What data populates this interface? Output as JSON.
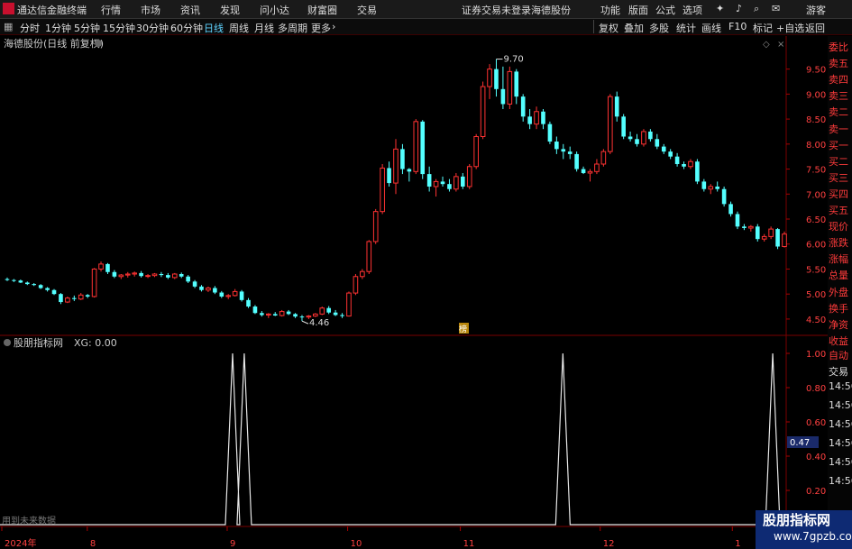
{
  "menubar": {
    "app_title": "通达信金融终端",
    "items": [
      "行情",
      "市场",
      "资讯",
      "发现",
      "问小达",
      "财富圈",
      "交易"
    ],
    "warning": "证券交易未登录",
    "stock_name": "海德股份",
    "right_items": [
      "功能",
      "版面",
      "公式",
      "选项"
    ],
    "user": "游客"
  },
  "toolbar": {
    "periods": [
      "分时",
      "1分钟",
      "5分钟",
      "15分钟",
      "30分钟",
      "60分钟",
      "日线",
      "周线",
      "月线",
      "多周期",
      "更多"
    ],
    "active_period": "日线",
    "right_items": [
      "复权",
      "叠加",
      "多股",
      "统计",
      "画线",
      "F10",
      "标记",
      "+自选",
      "返回"
    ]
  },
  "main_chart": {
    "title": "海德股份(日线 前复权)",
    "high_label": "9.70",
    "low_label": "4.46",
    "badge": "榜",
    "y_ticks": [
      "9.50",
      "9.00",
      "8.50",
      "8.00",
      "7.50",
      "7.00",
      "6.50",
      "6.00",
      "5.50",
      "5.00",
      "4.50"
    ]
  },
  "indicator": {
    "title": "股朋指标网",
    "value_label": "XG: 0.00",
    "y_ticks": [
      "1.00",
      "0.80",
      "0.60",
      "0.40",
      "0.20"
    ],
    "current_value": "0.47",
    "footnote": "用到未来数据"
  },
  "x_axis": {
    "labels": [
      "2024年",
      "8",
      "9",
      "10",
      "11",
      "12",
      "1"
    ]
  },
  "right_panel": {
    "side_labels": [
      "委比",
      "卖五",
      "卖四",
      "卖三",
      "卖二",
      "卖一",
      "买一",
      "买二",
      "买三",
      "买四",
      "买五",
      "现价",
      "涨跌",
      "涨幅",
      "总量",
      "外盘",
      "换手",
      "净资",
      "收益"
    ],
    "auto_label": "自动",
    "trade_label": "交易",
    "times": [
      "14:56",
      "14:56",
      "14:56",
      "14:56",
      "14:56",
      "14:56"
    ]
  },
  "watermark": {
    "line1": "股朋指标网",
    "line2": "www.7gpzb.com"
  },
  "chart_data": {
    "type": "candlestick",
    "title": "海德股份(日线 前复权)",
    "ylim": [
      4.3,
      9.8
    ],
    "x_labels": [
      "2024年",
      "8",
      "9",
      "10",
      "11",
      "12",
      "1"
    ],
    "candles": [
      [
        5.3,
        5.33,
        5.26,
        5.28
      ],
      [
        5.28,
        5.3,
        5.24,
        5.27
      ],
      [
        5.27,
        5.29,
        5.22,
        5.23
      ],
      [
        5.23,
        5.25,
        5.18,
        5.2
      ],
      [
        5.2,
        5.22,
        5.16,
        5.18
      ],
      [
        5.18,
        5.2,
        5.1,
        5.12
      ],
      [
        5.12,
        5.14,
        5.05,
        5.08
      ],
      [
        5.08,
        5.1,
        4.98,
        5.0
      ],
      [
        5.0,
        5.02,
        4.8,
        4.84
      ],
      [
        4.84,
        4.95,
        4.82,
        4.92
      ],
      [
        4.92,
        4.97,
        4.86,
        4.9
      ],
      [
        4.9,
        5.02,
        4.88,
        4.98
      ],
      [
        4.98,
        5.0,
        4.92,
        4.95
      ],
      [
        4.95,
        5.52,
        4.93,
        5.5
      ],
      [
        5.5,
        5.65,
        5.45,
        5.6
      ],
      [
        5.6,
        5.62,
        5.4,
        5.44
      ],
      [
        5.44,
        5.48,
        5.32,
        5.35
      ],
      [
        5.35,
        5.4,
        5.3,
        5.38
      ],
      [
        5.38,
        5.44,
        5.33,
        5.4
      ],
      [
        5.4,
        5.45,
        5.35,
        5.42
      ],
      [
        5.42,
        5.46,
        5.33,
        5.36
      ],
      [
        5.36,
        5.4,
        5.32,
        5.37
      ],
      [
        5.37,
        5.42,
        5.34,
        5.4
      ],
      [
        5.4,
        5.44,
        5.34,
        5.38
      ],
      [
        5.38,
        5.42,
        5.3,
        5.33
      ],
      [
        5.33,
        5.42,
        5.3,
        5.4
      ],
      [
        5.4,
        5.43,
        5.32,
        5.35
      ],
      [
        5.35,
        5.38,
        5.22,
        5.25
      ],
      [
        5.25,
        5.28,
        5.12,
        5.15
      ],
      [
        5.15,
        5.18,
        5.05,
        5.08
      ],
      [
        5.08,
        5.15,
        5.04,
        5.12
      ],
      [
        5.12,
        5.16,
        5.0,
        5.03
      ],
      [
        5.03,
        5.06,
        4.92,
        4.95
      ],
      [
        4.95,
        5.0,
        4.9,
        4.97
      ],
      [
        4.97,
        5.1,
        4.95,
        5.05
      ],
      [
        5.05,
        5.08,
        4.85,
        4.88
      ],
      [
        4.88,
        4.92,
        4.72,
        4.75
      ],
      [
        4.75,
        4.78,
        4.6,
        4.62
      ],
      [
        4.62,
        4.66,
        4.55,
        4.58
      ],
      [
        4.58,
        4.62,
        4.52,
        4.6
      ],
      [
        4.6,
        4.64,
        4.56,
        4.57
      ],
      [
        4.57,
        4.68,
        4.55,
        4.65
      ],
      [
        4.65,
        4.68,
        4.58,
        4.6
      ],
      [
        4.6,
        4.62,
        4.52,
        4.55
      ],
      [
        4.55,
        4.58,
        4.46,
        4.54
      ],
      [
        4.54,
        4.58,
        4.5,
        4.56
      ],
      [
        4.56,
        4.62,
        4.54,
        4.6
      ],
      [
        4.6,
        4.75,
        4.58,
        4.72
      ],
      [
        4.72,
        4.76,
        4.6,
        4.63
      ],
      [
        4.63,
        4.68,
        4.56,
        4.58
      ],
      [
        4.58,
        4.62,
        4.52,
        4.56
      ],
      [
        4.56,
        5.05,
        4.55,
        5.02
      ],
      [
        5.02,
        5.4,
        4.98,
        5.35
      ],
      [
        5.35,
        5.5,
        5.3,
        5.45
      ],
      [
        5.45,
        6.08,
        5.4,
        6.05
      ],
      [
        6.05,
        6.7,
        6.0,
        6.65
      ],
      [
        6.65,
        7.6,
        6.6,
        7.52
      ],
      [
        7.52,
        7.65,
        7.15,
        7.22
      ],
      [
        7.22,
        8.1,
        7.0,
        7.9
      ],
      [
        7.9,
        8.0,
        7.4,
        7.5
      ],
      [
        7.5,
        7.52,
        7.25,
        7.45
      ],
      [
        7.45,
        8.5,
        7.4,
        8.45
      ],
      [
        8.45,
        8.48,
        7.3,
        7.4
      ],
      [
        7.4,
        7.55,
        7.05,
        7.15
      ],
      [
        7.15,
        7.3,
        6.95,
        7.25
      ],
      [
        7.25,
        7.35,
        7.15,
        7.2
      ],
      [
        7.2,
        7.3,
        7.05,
        7.1
      ],
      [
        7.1,
        7.42,
        7.05,
        7.35
      ],
      [
        7.35,
        7.42,
        7.1,
        7.15
      ],
      [
        7.15,
        7.6,
        7.1,
        7.55
      ],
      [
        7.55,
        8.2,
        7.5,
        8.15
      ],
      [
        8.15,
        9.25,
        8.1,
        9.15
      ],
      [
        9.15,
        9.6,
        8.9,
        9.5
      ],
      [
        9.5,
        9.7,
        8.95,
        9.1
      ],
      [
        9.1,
        9.55,
        8.7,
        8.8
      ],
      [
        8.8,
        9.55,
        8.7,
        9.45
      ],
      [
        9.45,
        9.5,
        8.8,
        8.95
      ],
      [
        8.95,
        9.0,
        8.45,
        8.55
      ],
      [
        8.55,
        8.7,
        8.3,
        8.4
      ],
      [
        8.4,
        8.75,
        8.3,
        8.65
      ],
      [
        8.65,
        8.7,
        8.3,
        8.4
      ],
      [
        8.4,
        8.45,
        8.0,
        8.05
      ],
      [
        8.05,
        8.15,
        7.8,
        7.9
      ],
      [
        7.9,
        8.0,
        7.7,
        7.85
      ],
      [
        7.85,
        7.95,
        7.7,
        7.8
      ],
      [
        7.8,
        7.85,
        7.45,
        7.5
      ],
      [
        7.5,
        7.55,
        7.4,
        7.42
      ],
      [
        7.42,
        7.5,
        7.25,
        7.45
      ],
      [
        7.45,
        7.7,
        7.4,
        7.6
      ],
      [
        7.6,
        7.9,
        7.55,
        7.85
      ],
      [
        7.85,
        9.0,
        7.8,
        8.95
      ],
      [
        8.95,
        9.05,
        8.45,
        8.55
      ],
      [
        8.55,
        8.6,
        8.1,
        8.15
      ],
      [
        8.15,
        8.25,
        8.05,
        8.1
      ],
      [
        8.1,
        8.2,
        7.95,
        8.0
      ],
      [
        8.0,
        8.3,
        7.95,
        8.25
      ],
      [
        8.25,
        8.3,
        8.05,
        8.1
      ],
      [
        8.1,
        8.2,
        7.9,
        7.95
      ],
      [
        7.95,
        8.0,
        7.8,
        7.85
      ],
      [
        7.85,
        7.9,
        7.7,
        7.75
      ],
      [
        7.75,
        7.82,
        7.55,
        7.6
      ],
      [
        7.6,
        7.65,
        7.5,
        7.55
      ],
      [
        7.55,
        7.7,
        7.5,
        7.65
      ],
      [
        7.65,
        7.7,
        7.2,
        7.25
      ],
      [
        7.25,
        7.3,
        7.05,
        7.1
      ],
      [
        7.1,
        7.2,
        7.0,
        7.15
      ],
      [
        7.15,
        7.25,
        7.05,
        7.1
      ],
      [
        7.1,
        7.15,
        6.75,
        6.8
      ],
      [
        6.8,
        6.85,
        6.55,
        6.6
      ],
      [
        6.6,
        6.65,
        6.3,
        6.35
      ],
      [
        6.35,
        6.4,
        6.28,
        6.32
      ],
      [
        6.32,
        6.38,
        6.25,
        6.35
      ],
      [
        6.35,
        6.4,
        6.05,
        6.1
      ],
      [
        6.1,
        6.2,
        6.05,
        6.15
      ],
      [
        6.15,
        6.35,
        6.1,
        6.3
      ],
      [
        6.3,
        6.32,
        5.9,
        5.95
      ],
      [
        5.95,
        6.25,
        5.93,
        6.2
      ]
    ],
    "indicator": {
      "name": "XG",
      "ylim": [
        0,
        1.0
      ],
      "signal_positions": [
        0.29,
        0.305,
        0.715,
        0.985
      ]
    }
  }
}
